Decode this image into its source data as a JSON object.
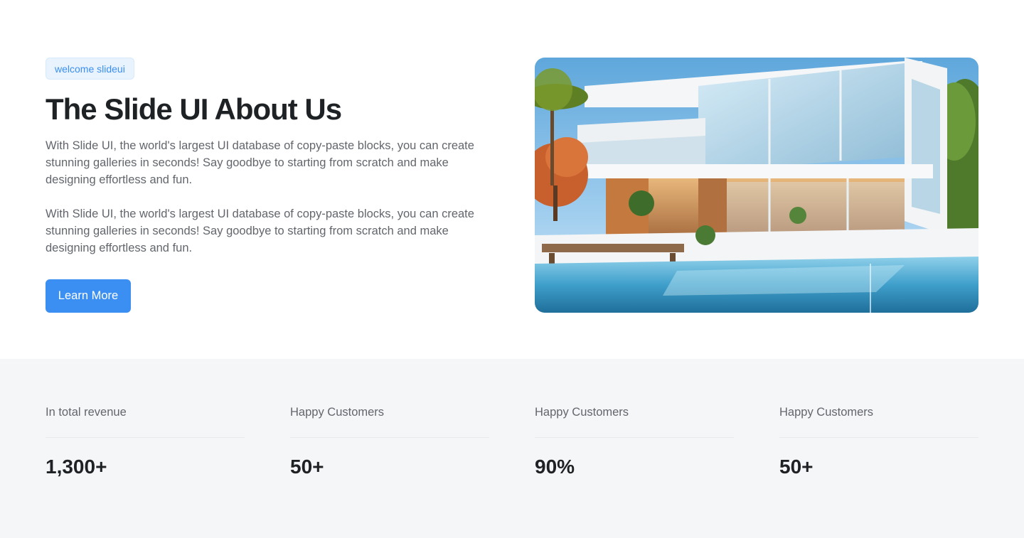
{
  "hero": {
    "badge": "welcome slideui",
    "title": "The Slide UI About Us",
    "paragraphs": [
      "With Slide UI, the world's largest UI database of copy-paste blocks, you can create stunning galleries in seconds! Say goodbye to starting from scratch and make designing effortless and fun.",
      "With Slide UI, the world's largest UI database of copy-paste blocks, you can create stunning galleries in seconds! Say goodbye to starting from scratch and make designing effortless and fun."
    ],
    "cta_label": "Learn More",
    "image_alt": "modern-villa-with-pool-photo"
  },
  "stats": [
    {
      "label": "In total revenue",
      "value": "1,300+"
    },
    {
      "label": "Happy Customers",
      "value": "50+"
    },
    {
      "label": "Happy Customers",
      "value": "90%"
    },
    {
      "label": "Happy Customers",
      "value": "50+"
    }
  ],
  "colors": {
    "accent": "#3b8ff3",
    "badge_bg": "#e8f3fe",
    "badge_text": "#3a8ff0",
    "heading": "#1f2225",
    "body_text": "#62666c",
    "stats_bg": "#f5f6f8"
  }
}
